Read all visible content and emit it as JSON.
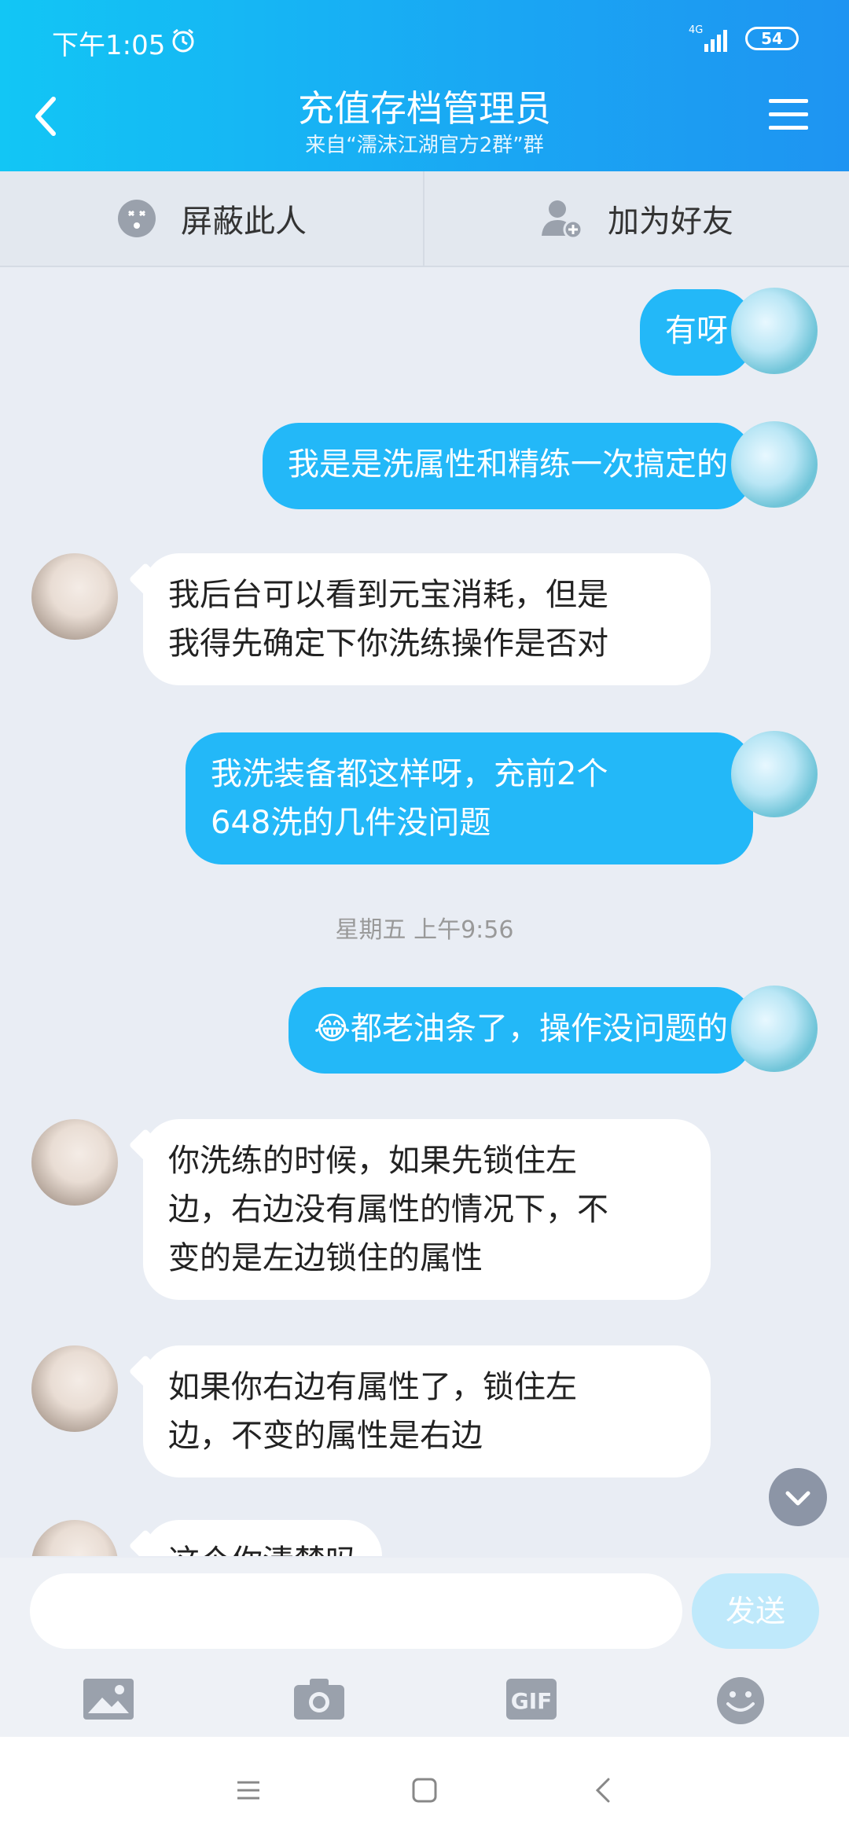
{
  "status": {
    "time": "下午1:05",
    "network": "4G",
    "battery": "54"
  },
  "header": {
    "title": "充值存档管理员",
    "subtitle": "来自“濡沫江湖官方2群”群"
  },
  "actions": {
    "block": "屏蔽此人",
    "add_friend": "加为好友"
  },
  "messages": [
    {
      "from": "me",
      "text": "有呀"
    },
    {
      "from": "me",
      "text": "我是是洗属性和精练一次搞定的"
    },
    {
      "from": "them",
      "lines": [
        "我后台可以看到元宝消耗，但是",
        "我得先确定下你洗练操作是否对"
      ]
    },
    {
      "from": "me",
      "lines": [
        "我洗装备都这样呀，充前2个",
        "648洗的几件没问题"
      ]
    },
    {
      "from": "me",
      "emoji": "😂",
      "text": "都老油条了，操作没问题的"
    },
    {
      "from": "them",
      "lines": [
        "你洗练的时候，如果先锁住左",
        "边，右边没有属性的情况下，不",
        "变的是左边锁住的属性"
      ]
    },
    {
      "from": "them",
      "lines": [
        "如果你右边有属性了，锁住左",
        "边，不变的属性是右边"
      ]
    },
    {
      "from": "them",
      "text": "这个你清楚吗"
    }
  ],
  "timestamp": "星期五 上午9:56",
  "input": {
    "placeholder": "",
    "send_label": "发送"
  },
  "toolbar": {
    "gif_label": "GIF"
  }
}
